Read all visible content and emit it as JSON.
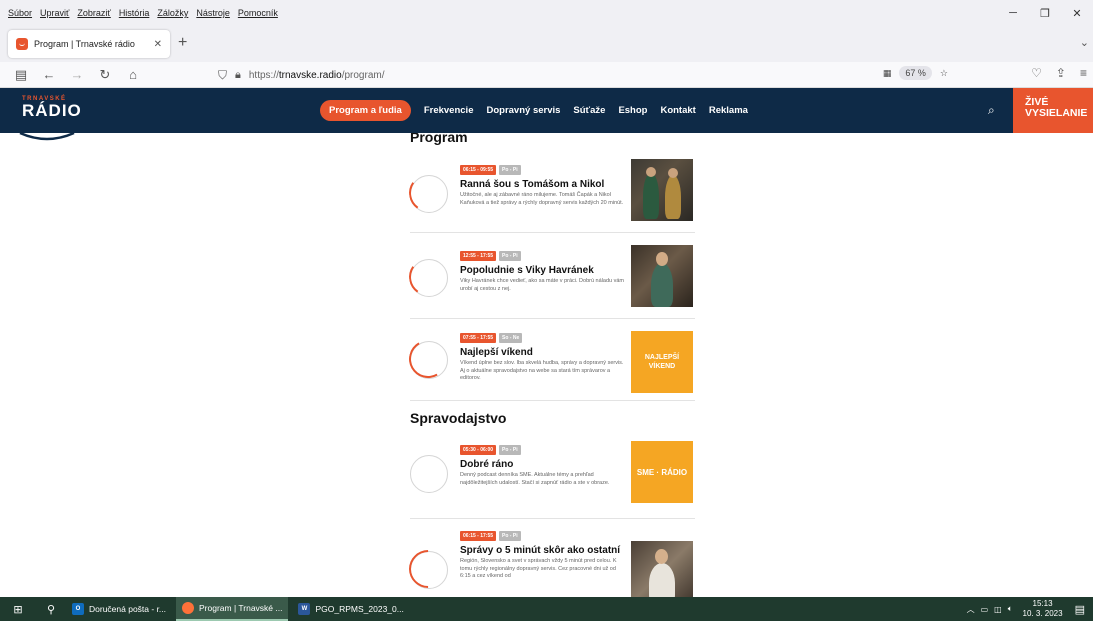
{
  "menubar": {
    "items": [
      "Súbor",
      "Upraviť",
      "Zobraziť",
      "História",
      "Záložky",
      "Nástroje",
      "Pomocník"
    ]
  },
  "window_controls": {
    "minimize": "─",
    "restore": "❐",
    "close": "✕"
  },
  "tab": {
    "title": "Program | Trnavské rádio",
    "close": "✕",
    "new_tab": "+",
    "chevron": "⌄"
  },
  "navbar": {
    "url_prefix": "https://",
    "url_host": "trnavske.radio",
    "url_path": "/program/",
    "zoom": "67 %"
  },
  "site": {
    "logo_small": "TRNAVSKÉ",
    "logo_big": "RÁDIO",
    "nav": [
      "Program a ľudia",
      "Frekvencie",
      "Dopravný servis",
      "Súťaže",
      "Eshop",
      "Kontakt",
      "Reklama"
    ],
    "live_line1": "ŽIVÉ",
    "live_line2": "VYSIELANIE"
  },
  "sections": {
    "program_title": "Program",
    "news_title": "Spravodajstvo"
  },
  "shows": [
    {
      "time": "06:15 - 09:55",
      "days": "Po - Pi",
      "name": "Ranná šou s Tomášom a Nikol",
      "desc": "Užitočné, ale aj zábavné ráno milujeme. Tomáš Čapák a Nikol Kaňuková a tiež správy a rýchly dopravný servis každých 20 minút."
    },
    {
      "time": "12:55 - 17:55",
      "days": "Po - Pi",
      "name": "Popoludnie s Viky Havránek",
      "desc": "Viky Havránek chce vedieť, ako sa máte v práci. Dobrú náladu vám urobí aj cestou z nej."
    },
    {
      "time": "07:55 - 17:55",
      "days": "So - Ne",
      "name": "Najlepší víkend",
      "desc": "Víkend úplne bez slov. Iba skvelá hudba, správy a dopravný servis. Aj o aktuálne spravodajstvo na webe sa stará tím správarov a editorov.",
      "thumb_text": "NAJLEPŠÍ VÍKEND"
    },
    {
      "time": "05:30 - 06:00",
      "days": "Po - Pi",
      "name": "Dobré ráno",
      "desc": "Denný podcast denníka SME. Aktuálne témy a prehľad najdôležitejších udalostí. Stačí si zapnúť rádio a ste v obraze.",
      "thumb_text": "SME · RÁDIO"
    },
    {
      "time": "06:15 - 17:55",
      "days": "Po - Pi",
      "name": "Správy o 5 minút skôr ako ostatní",
      "desc": "Región, Slovensko a svet v správach vždy 5 minút pred celou. K tomu rýchly regionálny dopravný servis. Cez pracovné dni už od 6:15 a cez víkend od"
    }
  ],
  "taskbar": {
    "items": [
      {
        "label": "Doručená pošta - r...",
        "icon": "O"
      },
      {
        "label": "Program | Trnavské ...",
        "icon": ""
      },
      {
        "label": "PGO_RPMS_2023_0...",
        "icon": "W"
      }
    ],
    "time": "15:13",
    "date": "10. 3. 2023"
  },
  "colors": {
    "brand_navy": "#0e2a47",
    "brand_orange": "#e8552e",
    "yellow_thumb": "#f5a623"
  }
}
